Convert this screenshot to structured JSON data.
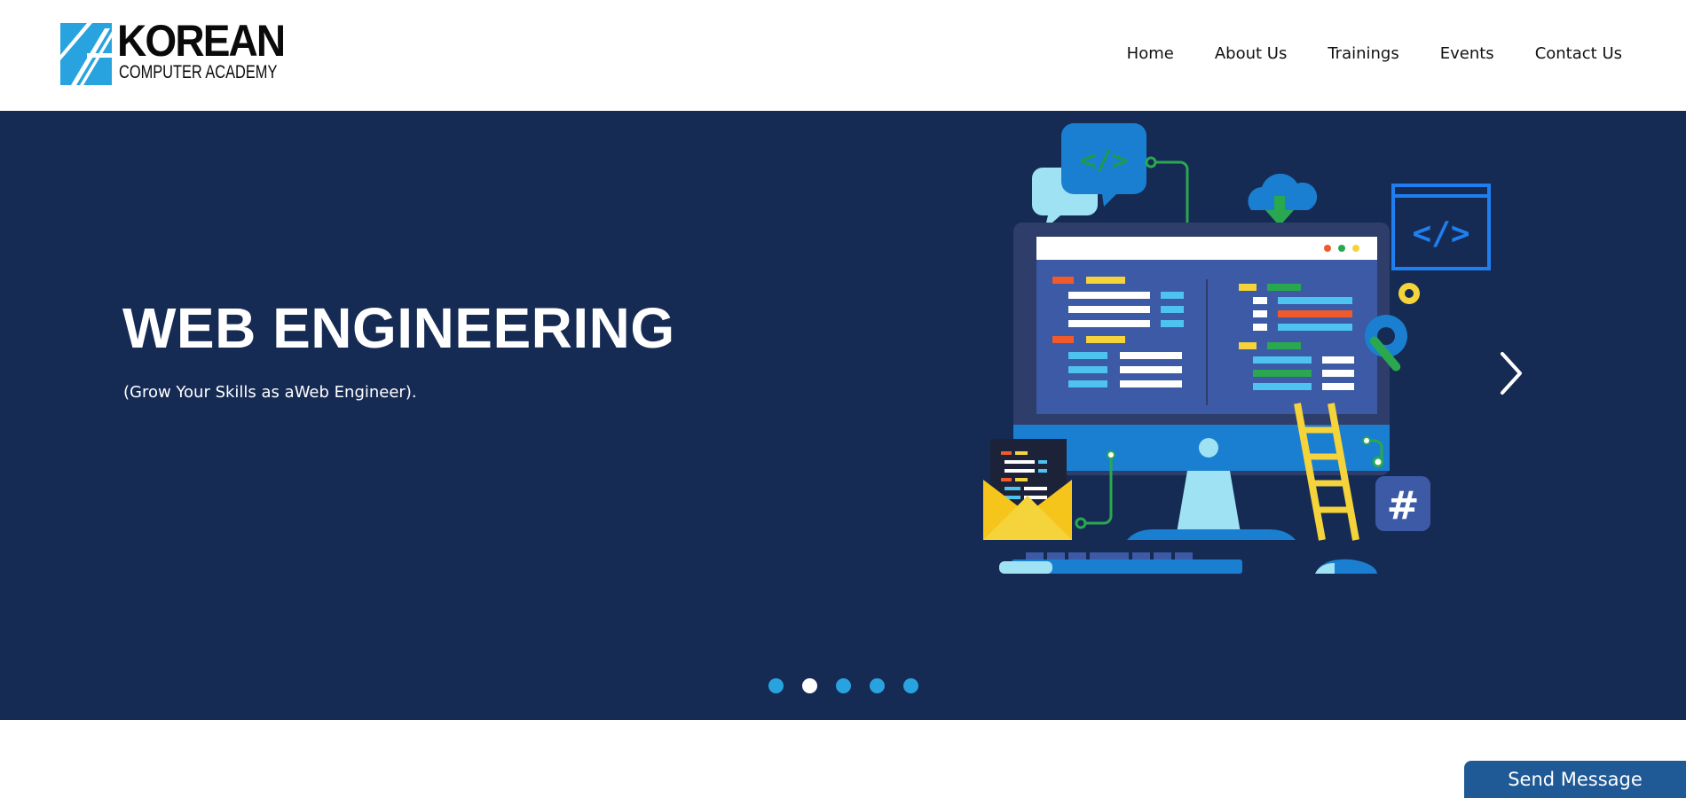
{
  "brand": {
    "name_line1": "KOREAN",
    "name_line2": "COMPUTER ACADEMY",
    "mark_color": "#29a3df"
  },
  "nav": {
    "items": [
      {
        "label": "Home"
      },
      {
        "label": "About Us"
      },
      {
        "label": "Trainings"
      },
      {
        "label": "Events"
      },
      {
        "label": "Contact Us"
      }
    ]
  },
  "hero": {
    "title": "WEB ENGINEERING",
    "subtitle": "(Grow Your Skills as aWeb Engineer).",
    "background": "#162b54",
    "slides_count": 5,
    "active_slide": 2,
    "next_icon": "chevron-right-icon"
  },
  "widget": {
    "send_message_label": "Send Message",
    "color": "#1f5a96"
  }
}
